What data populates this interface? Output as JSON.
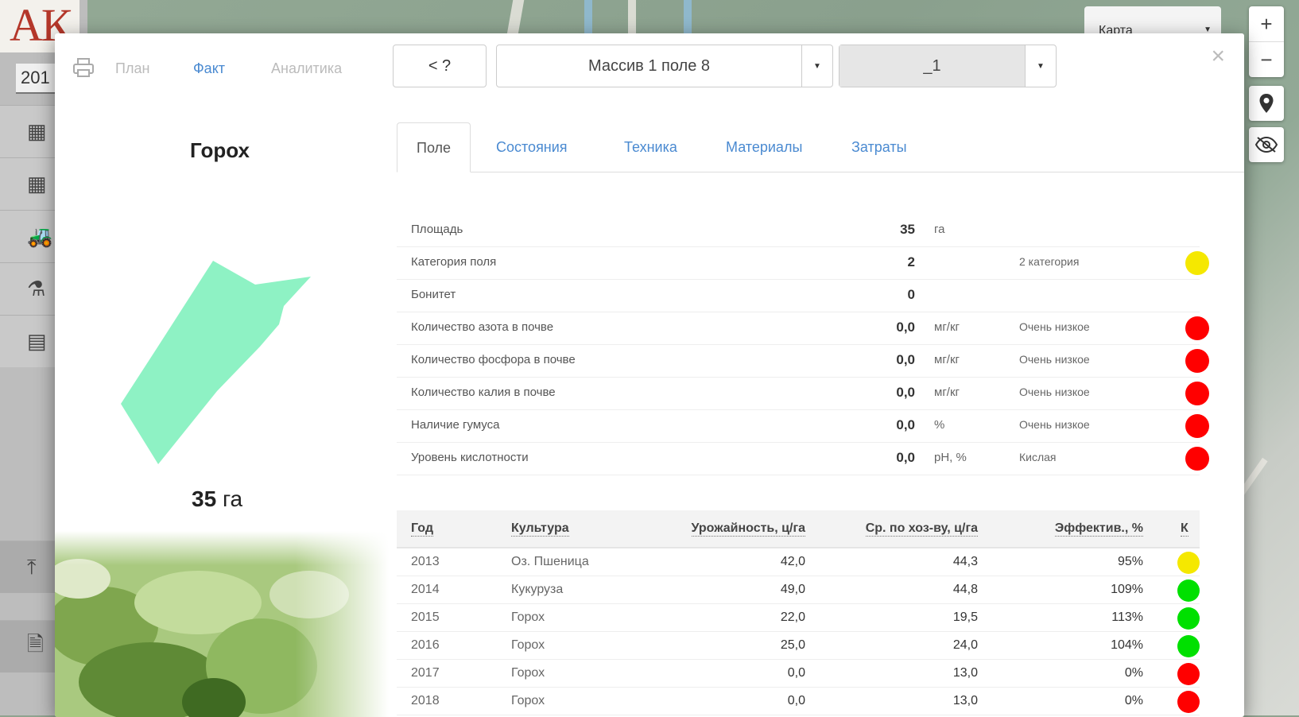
{
  "app": {
    "logo_text": "АК",
    "year": "201"
  },
  "map": {
    "layer_select": "Карта"
  },
  "modal": {
    "tabs": [
      {
        "label": "План",
        "active": false
      },
      {
        "label": "Факт",
        "active": true
      },
      {
        "label": "Аналитика",
        "active": false
      }
    ],
    "back_label": "< ?",
    "field_select": "Массив 1 поле 8",
    "variant_select": "_1",
    "close_label": "×"
  },
  "field": {
    "culture": "Горох",
    "area_value": "35",
    "area_unit": "га"
  },
  "section_tabs": [
    {
      "label": "Поле",
      "active": true
    },
    {
      "label": "Состояния",
      "active": false
    },
    {
      "label": "Техника",
      "active": false
    },
    {
      "label": "Материалы",
      "active": false
    },
    {
      "label": "Затраты",
      "active": false
    }
  ],
  "properties": [
    {
      "label": "Площадь",
      "value": "35",
      "unit": "га",
      "desc": "",
      "status": ""
    },
    {
      "label": "Категория поля",
      "value": "2",
      "unit": "",
      "desc": "2 категория",
      "status": "#f5e800"
    },
    {
      "label": "Бонитет",
      "value": "0",
      "unit": "",
      "desc": "",
      "status": ""
    },
    {
      "label": "Количество азота в почве",
      "value": "0,0",
      "unit": "мг/кг",
      "desc": "Очень низкое",
      "status": "#ff0000"
    },
    {
      "label": "Количество фосфора в почве",
      "value": "0,0",
      "unit": "мг/кг",
      "desc": "Очень низкое",
      "status": "#ff0000"
    },
    {
      "label": "Количество калия в почве",
      "value": "0,0",
      "unit": "мг/кг",
      "desc": "Очень низкое",
      "status": "#ff0000"
    },
    {
      "label": "Наличие гумуса",
      "value": "0,0",
      "unit": "%",
      "desc": "Очень низкое",
      "status": "#ff0000"
    },
    {
      "label": "Уровень кислотности",
      "value": "0,0",
      "unit": "pH, %",
      "desc": "Кислая",
      "status": "#ff0000"
    }
  ],
  "history": {
    "headers": [
      "Год",
      "Культура",
      "Урожайность, ц/га",
      "Ср. по хоз-ву, ц/га",
      "Эффектив., %",
      "К"
    ],
    "rows": [
      {
        "year": "2013",
        "crop": "Оз. Пшеница",
        "yield": "42,0",
        "avg": "44,3",
        "eff": "95%",
        "status": "#f5e800"
      },
      {
        "year": "2014",
        "crop": "Кукуруза",
        "yield": "49,0",
        "avg": "44,8",
        "eff": "109%",
        "status": "#00e000"
      },
      {
        "year": "2015",
        "crop": "Горох",
        "yield": "22,0",
        "avg": "19,5",
        "eff": "113%",
        "status": "#00e000"
      },
      {
        "year": "2016",
        "crop": "Горох",
        "yield": "25,0",
        "avg": "24,0",
        "eff": "104%",
        "status": "#00e000"
      },
      {
        "year": "2017",
        "crop": "Горох",
        "yield": "0,0",
        "avg": "13,0",
        "eff": "0%",
        "status": "#ff0000"
      },
      {
        "year": "2018",
        "crop": "Горох",
        "yield": "0,0",
        "avg": "13,0",
        "eff": "0%",
        "status": "#ff0000"
      }
    ]
  },
  "icons": [
    "print-icon",
    "map-layer-icon",
    "tractor-icon",
    "fertilizer-icon",
    "calculator-icon",
    "upload-icon",
    "document-icon",
    "zoom-in-icon",
    "zoom-out-icon",
    "location-pin-icon",
    "eye-off-icon"
  ],
  "colors": {
    "accent": "#4a8ad1",
    "field_fill": "#8ef2c4"
  }
}
